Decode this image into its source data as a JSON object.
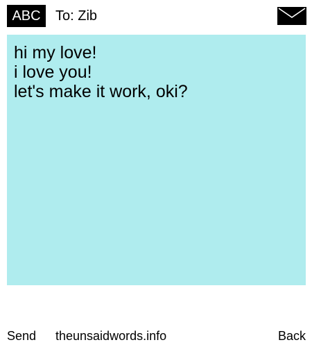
{
  "header": {
    "input_mode": "ABC",
    "recipient": "To: Zib",
    "envelope_icon": "envelope-icon"
  },
  "message": {
    "lines": [
      "hi my love!",
      "i love you!",
      "let's make it work, oki?"
    ],
    "background_color": "#afecee"
  },
  "footer": {
    "send_label": "Send",
    "site_label": "theunsaidwords.info",
    "back_label": "Back"
  }
}
